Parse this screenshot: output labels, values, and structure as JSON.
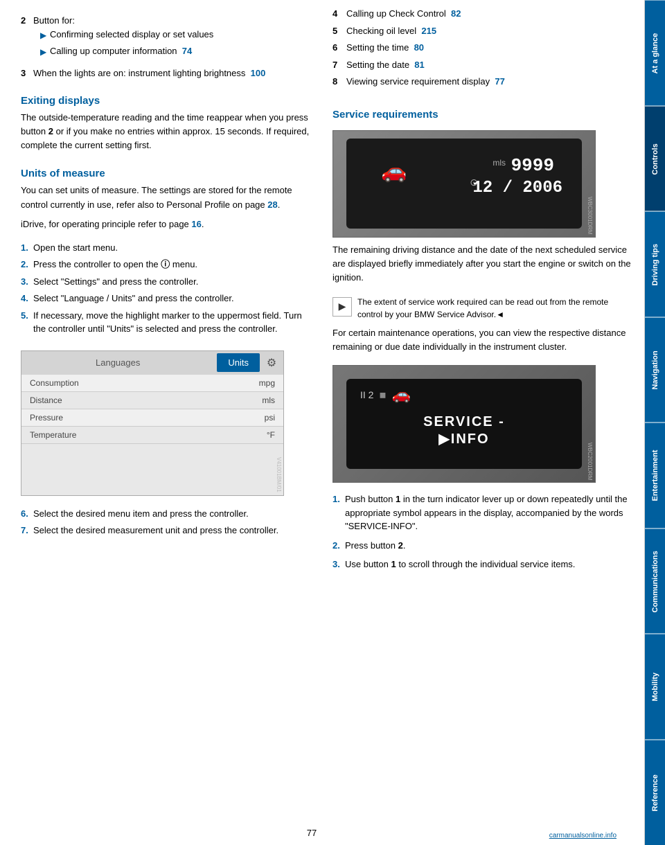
{
  "sidebar": {
    "tabs": [
      {
        "label": "At a glance",
        "active": false
      },
      {
        "label": "Controls",
        "active": true
      },
      {
        "label": "Driving tips",
        "active": false
      },
      {
        "label": "Navigation",
        "active": false
      },
      {
        "label": "Entertainment",
        "active": false
      },
      {
        "label": "Communications",
        "active": false
      },
      {
        "label": "Mobility",
        "active": false
      },
      {
        "label": "Reference",
        "active": false
      }
    ]
  },
  "left_col": {
    "intro_item2": {
      "num": "2",
      "label": "Button for:",
      "bullets": [
        "Confirming selected display or set values",
        "Calling up computer information   74"
      ]
    },
    "intro_item3": {
      "num": "3",
      "label": "When the lights are on: instrument lighting brightness   100"
    },
    "exiting_heading": "Exiting displays",
    "exiting_para": "The outside-temperature reading and the time reappear when you press button 2 or if you make no entries within approx. 15 seconds. If required, complete the current setting first.",
    "units_heading": "Units of measure",
    "units_para1": "You can set units of measure. The settings are stored for the remote control currently in use, refer also to Personal Profile on page 28.",
    "units_para2": "iDrive, for operating principle refer to page 16.",
    "units_steps": [
      {
        "num": "1.",
        "text": "Open the start menu."
      },
      {
        "num": "2.",
        "text": "Press the controller to open the Ⓘ menu."
      },
      {
        "num": "3.",
        "text": "Select \"Settings\" and press the controller."
      },
      {
        "num": "4.",
        "text": "Select \"Language / Units\" and press the controller."
      },
      {
        "num": "5.",
        "text": "If necessary, move the highlight marker to the uppermost field. Turn the controller until \"Units\" is selected and press the controller."
      }
    ],
    "units_table": {
      "tab_lang": "Languages",
      "tab_units": "Units",
      "rows": [
        {
          "label": "Consumption",
          "value": "mpg"
        },
        {
          "label": "Distance",
          "value": "mls"
        },
        {
          "label": "Pressure",
          "value": "psi"
        },
        {
          "label": "Temperature",
          "value": "°F"
        }
      ]
    },
    "units_steps_cont": [
      {
        "num": "6.",
        "text": "Select the desired menu item and press the controller."
      },
      {
        "num": "7.",
        "text": "Select the desired measurement unit and press the controller."
      }
    ]
  },
  "right_col": {
    "items_list": [
      {
        "num": "4",
        "text": "Calling up Check Control",
        "page": "82"
      },
      {
        "num": "5",
        "text": "Checking oil level",
        "page": "215"
      },
      {
        "num": "6",
        "text": "Setting the time",
        "page": "80"
      },
      {
        "num": "7",
        "text": "Setting the date",
        "page": "81"
      },
      {
        "num": "8",
        "text": "Viewing service requirement display",
        "page": "77"
      }
    ],
    "service_heading": "Service requirements",
    "service_img_mils": "mls",
    "service_img_val": "9999",
    "service_img_date": "12 / 2006",
    "service_para1": "The remaining driving distance and the date of the next scheduled service are displayed briefly immediately after you start the engine or switch on the ignition.",
    "service_note": "The extent of service work required can be read out from the remote control by your BMW Service Advisor.◄",
    "service_para2": "For certain maintenance operations, you can view the respective distance remaining or due date individually in the instrument cluster.",
    "service_info_text1": "SERVICE -",
    "service_info_text2": "▶INFO",
    "service_steps": [
      {
        "num": "1.",
        "text": "Push button 1 in the turn indicator lever up or down repeatedly until the appropriate symbol appears in the display, accompanied by the words \"SERVICE-INFO\"."
      },
      {
        "num": "2.",
        "text": "Press button 2."
      },
      {
        "num": "3.",
        "text": "Use button 1 to scroll through the individual service items."
      }
    ]
  },
  "footer": {
    "page_num": "77",
    "watermark": "carmanualsonline.info"
  }
}
